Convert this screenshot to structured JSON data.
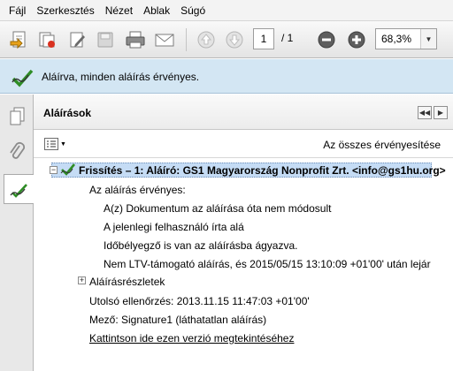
{
  "menu": {
    "items": [
      "Fájl",
      "Szerkesztés",
      "Nézet",
      "Ablak",
      "Súgó"
    ]
  },
  "toolbar": {
    "page_value": "1",
    "page_total": "/ 1",
    "zoom_value": "68,3%"
  },
  "banner": {
    "text": "Aláírva, minden aláírás érvényes."
  },
  "panel": {
    "title": "Aláírások",
    "validate_all": "Az összes érvényesítése"
  },
  "tree": {
    "root_label": "Frissítés – 1: Aláíró: GS1 Magyarország Nonprofit Zrt. <info@gs1hu.org>",
    "valid": "Az aláírás érvényes:",
    "detail1": "A(z) Dokumentum az aláírása óta nem módosult",
    "detail2": "A jelenlegi felhasználó írta alá",
    "detail3": "Időbélyegző is van az aláírásba ágyazva.",
    "detail4": "Nem LTV-támogató aláírás, és 2015/05/15 13:10:09 +01'00' után lejár",
    "details_node": "Aláírásrészletek",
    "last_checked": "Utolsó ellenőrzés: 2013.11.15 11:47:03 +01'00'",
    "field": "Mező: Signature1 (láthatatlan aláírás)",
    "view_version_link": "Kattintson ide ezen verzió megtekintéséhez"
  }
}
